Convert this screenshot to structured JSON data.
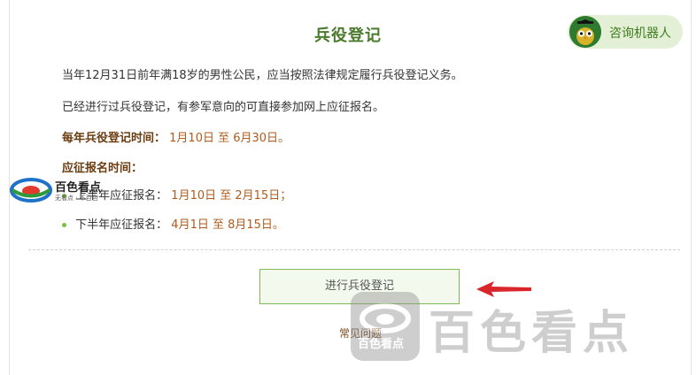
{
  "header": {
    "title": "兵役登记",
    "robot_button_label": "咨询机器人"
  },
  "content": {
    "line1": "当年12月31日前年满18岁的男性公民，应当按照法律规定履行兵役登记义务。",
    "line2": "已经进行过兵役登记，有参军意向的可直接参加网上应征报名。",
    "registration_time_label": "每年兵役登记时间：",
    "registration_time_value": "1月10日 至 6月30日。",
    "enlistment_time_label": "应征报名时间：",
    "first_half_label": "上半年应征报名：",
    "first_half_value": "1月10日 至 2月15日；",
    "second_half_label": "下半年应征报名：",
    "second_half_value": "4月1日 至 8月15日。"
  },
  "actions": {
    "register_button_label": "进行兵役登记",
    "faq_link_label": "常见问题"
  },
  "watermarks": {
    "small_text": "百色看点",
    "small_subtext": "无看点 · 不百色",
    "large_text": "百色看点",
    "large_subtext": "百色看点"
  },
  "colors": {
    "accent_green": "#4a7a2c",
    "button_border": "#7fbb52",
    "date_color": "#b05a1c",
    "arrow_red": "#d8262b"
  },
  "icons": {
    "robot_avatar": "owl-graduate-icon",
    "arrow": "red-arrow-icon",
    "bullet": "green-dot-icon"
  }
}
